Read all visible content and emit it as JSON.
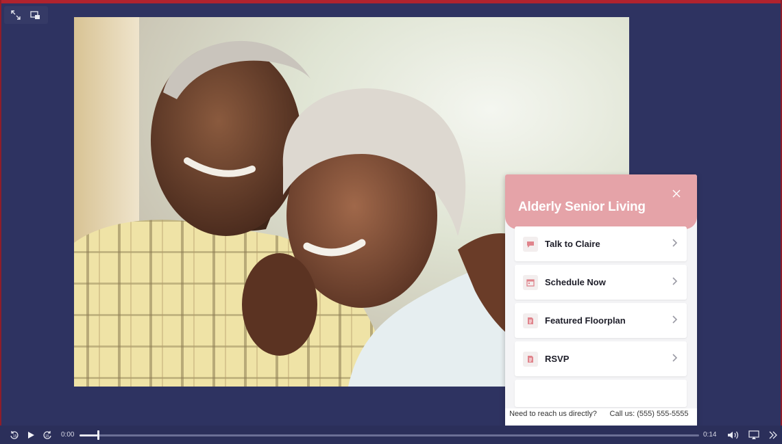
{
  "player": {
    "current_time": "0:00",
    "duration": "0:14",
    "progress": 0.03
  },
  "widget": {
    "title": "Alderly Senior Living",
    "items": [
      {
        "label": "Talk to Claire",
        "icon": "chat-bubble-icon"
      },
      {
        "label": "Schedule Now",
        "icon": "calendar-icon"
      },
      {
        "label": "Featured Floorplan",
        "icon": "document-icon"
      },
      {
        "label": "RSVP",
        "icon": "document-icon"
      }
    ],
    "footer_left": "Need to reach us directly?",
    "footer_right": "Call us: (555) 555-5555"
  },
  "colors": {
    "background": "#2e3361",
    "accent": "#e5a3a8",
    "frame": "#b0232e"
  }
}
